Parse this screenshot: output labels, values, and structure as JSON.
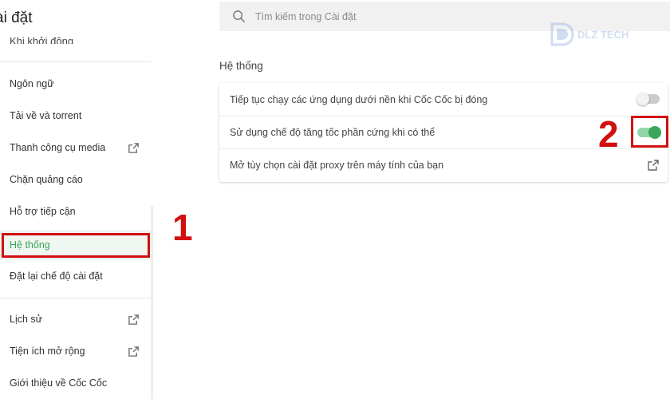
{
  "sidebar": {
    "title": "ài đặt",
    "partial_item": "Khi khởi động",
    "items": [
      {
        "label": "Ngôn ngữ",
        "external": false
      },
      {
        "label": "Tải về và torrent",
        "external": false
      },
      {
        "label": "Thanh công cụ media",
        "external": true
      },
      {
        "label": "Chặn quảng cáo",
        "external": false
      },
      {
        "label": "Hỗ trợ tiếp cận",
        "external": false
      },
      {
        "label": "Hệ thống",
        "external": false,
        "active": true
      },
      {
        "label": "Đặt lại chế độ cài đặt",
        "external": false
      },
      {
        "label": "Lịch sử",
        "external": true
      },
      {
        "label": "Tiện ích mở rộng",
        "external": true
      },
      {
        "label": "Giới thiệu về Cốc Cốc",
        "external": false
      }
    ]
  },
  "search": {
    "placeholder": "Tìm kiếm trong Cài đặt"
  },
  "watermark": {
    "text": "DLZ TECH"
  },
  "main": {
    "section_title": "Hệ thống",
    "rows": [
      {
        "label": "Tiếp tục chạy các ứng dụng dưới nền khi Cốc Cốc bị đóng",
        "toggle": "off"
      },
      {
        "label": "Sử dụng chế độ tăng tốc phần cứng khi có thể",
        "toggle": "on"
      },
      {
        "label": "Mở tùy chọn cài đặt proxy trên máy tính của bạn",
        "toggle": "external-link"
      }
    ]
  },
  "annotations": {
    "step1": "1",
    "step2": "2"
  },
  "colors": {
    "accent": "#3aa55a",
    "annotation": "#d20f0f",
    "active_bg": "#f0f7f1"
  }
}
